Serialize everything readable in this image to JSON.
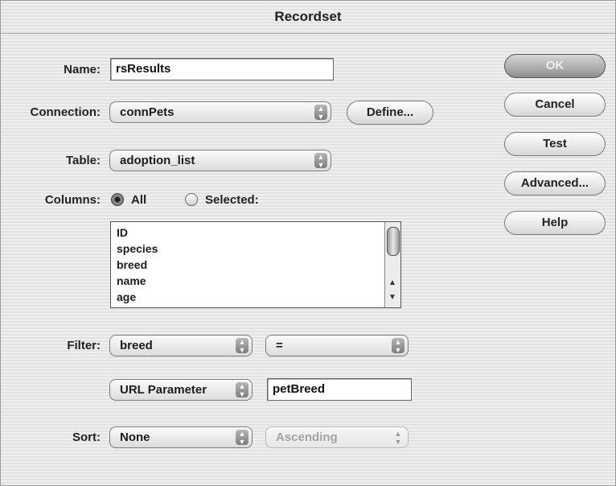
{
  "dialog": {
    "title": "Recordset"
  },
  "name": {
    "label": "Name:",
    "value": "rsResults"
  },
  "connection": {
    "label": "Connection:",
    "value": "connPets",
    "define_label": "Define..."
  },
  "table": {
    "label": "Table:",
    "value": "adoption_list"
  },
  "columns": {
    "label": "Columns:",
    "all_label": "All",
    "selected_label": "Selected:",
    "selected_option": "All",
    "items": [
      "ID",
      "species",
      "breed",
      "name",
      "age"
    ]
  },
  "filter": {
    "label": "Filter:",
    "column": "breed",
    "operator": "=",
    "source": "URL Parameter",
    "value": "petBreed"
  },
  "sort": {
    "label": "Sort:",
    "column": "None",
    "order": "Ascending"
  },
  "buttons": {
    "ok": "OK",
    "cancel": "Cancel",
    "test": "Test",
    "advanced": "Advanced...",
    "help": "Help"
  }
}
